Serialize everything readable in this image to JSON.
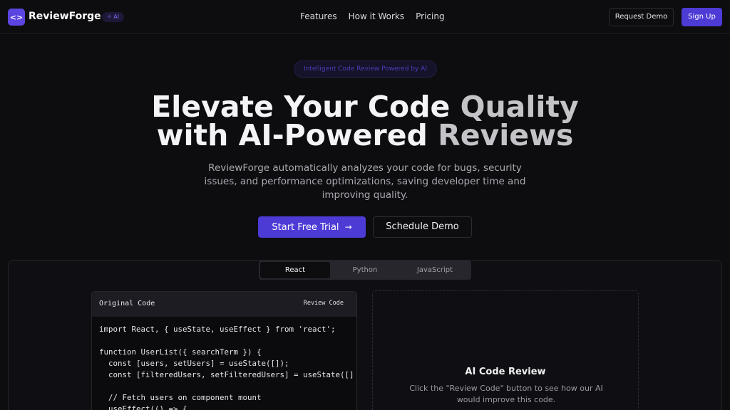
{
  "nav": {
    "brand": "ReviewForge",
    "badge": "✧ AI",
    "links": [
      "Features",
      "How it Works",
      "Pricing"
    ],
    "request_demo": "Request Demo",
    "sign_up": "Sign Up"
  },
  "hero": {
    "pill": "Intelligent Code Review Powered by AI",
    "title_line1_a": "Elevate Your Code ",
    "title_line1_b": "Quality",
    "title_line2_a": "with AI-Powered ",
    "title_line2_b": "Reviews",
    "subtitle": "ReviewForge automatically analyzes your code for bugs, security issues, and performance optimizations, saving developer time and improving quality.",
    "cta_primary": "Start Free Trial",
    "cta_secondary": "Schedule Demo"
  },
  "demo": {
    "tabs": [
      "React",
      "Python",
      "JavaScript"
    ],
    "active_tab": "React",
    "code_label": "Original Code",
    "review_button": "Review Code",
    "code_lines": [
      "import React, { useState, useEffect } from 'react';",
      "",
      "function UserList({ searchTerm }) {",
      "  const [users, setUsers] = useState([]);",
      "  const [filteredUsers, setFilteredUsers] = useState([]",
      "",
      "  // Fetch users on component mount",
      "  useEffect(() => {"
    ],
    "review_title": "AI Code Review",
    "review_text": "Click the \"Review Code\" button to see how our AI would improve this code."
  },
  "colors": {
    "accent": "#4d3bd6",
    "background": "#0d0d10"
  }
}
